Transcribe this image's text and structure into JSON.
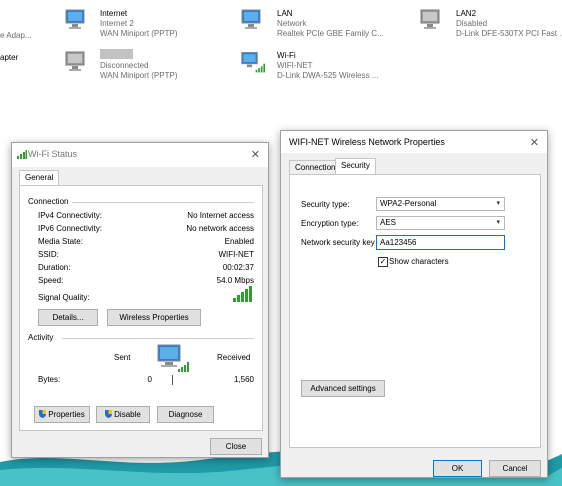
{
  "network_list": [
    {
      "name": "Internet",
      "line2": "Internet 2",
      "line3": "WAN Miniport (PPTP)"
    },
    {
      "name": "LAN",
      "line2": "Network",
      "line3": "Realtek PCIe GBE Family C..."
    },
    {
      "name": "LAN2",
      "line2": "Disabled",
      "line3": "D-Link DFE-530TX PCI Fast ..."
    },
    {
      "name": "",
      "line2": "Disconnected",
      "line3": "WAN Miniport (PPTP)"
    },
    {
      "name": "Wi-Fi",
      "line2": "WIFI-NET",
      "line3": "D-Link DWA-525 Wireless ..."
    }
  ],
  "cut_labels": {
    "left1": "e Adap...",
    "left2": "apter"
  },
  "wifi_status": {
    "title": "Wi-Fi Status",
    "tab": "General",
    "connection_header": "Connection",
    "rows": [
      {
        "label": "IPv4 Connectivity:",
        "value": "No Internet access"
      },
      {
        "label": "IPv6 Connectivity:",
        "value": "No network access"
      },
      {
        "label": "Media State:",
        "value": "Enabled"
      },
      {
        "label": "SSID:",
        "value": "WIFI-NET"
      },
      {
        "label": "Duration:",
        "value": "00:02:37"
      },
      {
        "label": "Speed:",
        "value": "54.0 Mbps"
      }
    ],
    "signal_label": "Signal Quality:",
    "details_button": "Details...",
    "wireless_properties_button": "Wireless Properties",
    "activity_header": "Activity",
    "sent_label": "Sent",
    "received_label": "Received",
    "bytes_label": "Bytes:",
    "bytes_sent": "0",
    "bytes_received": "1,560",
    "properties_button": "Properties",
    "disable_button": "Disable",
    "diagnose_button": "Diagnose",
    "close_button": "Close"
  },
  "props": {
    "title": "WIFI-NET Wireless Network Properties",
    "tabs": [
      "Connection",
      "Security"
    ],
    "security_type_label": "Security type:",
    "security_type_value": "WPA2-Personal",
    "encryption_type_label": "Encryption type:",
    "encryption_type_value": "AES",
    "key_label": "Network security key",
    "key_value": "Aa123456",
    "show_characters_label": "Show characters",
    "advanced_button": "Advanced settings",
    "ok_button": "OK",
    "cancel_button": "Cancel"
  },
  "colors": {
    "accent": "#0078d7",
    "signal_green": "#2e9e2e",
    "window_bg": "#f0f0f0"
  }
}
